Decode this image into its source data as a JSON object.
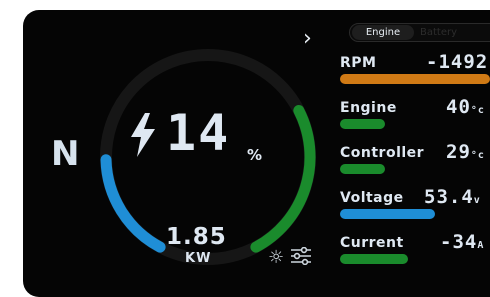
{
  "dashboard": {
    "gear": "N",
    "nav_chevron": "›",
    "charge_percent": "14",
    "charge_unit": "%",
    "power_value": "1.85",
    "power_unit": "KW",
    "gauge_left_level": 0.55,
    "gauge_right_level": 0.45,
    "gauge_left_color": "#1f8ed6",
    "gauge_right_color": "#1a8b2c",
    "bolt_icon": "lightning-bolt-icon",
    "brightness_icon": "sun-icon",
    "settings_icon": "sliders-icon"
  },
  "tabs": [
    {
      "label": "Engine",
      "active": true
    },
    {
      "label": "Battery",
      "active": false
    }
  ],
  "metrics": [
    {
      "label": "RPM",
      "value": "-1492",
      "unit": "",
      "bar_color": "#d07a15",
      "bar_level": 1.0
    },
    {
      "label": "Engine",
      "value": "40",
      "unit": "°c",
      "bar_color": "#1a8b2c",
      "bar_level": 0.3
    },
    {
      "label": "Controller",
      "value": "29",
      "unit": "°c",
      "bar_color": "#1a8b2c",
      "bar_level": 0.3
    },
    {
      "label": "Voltage",
      "value": "53.4",
      "unit": "v",
      "bar_color": "#1f8ed6",
      "bar_level": 0.63
    },
    {
      "label": "Current",
      "value": "-34",
      "unit": "A",
      "bar_color": "#1a8b2c",
      "bar_level": 0.45
    }
  ]
}
